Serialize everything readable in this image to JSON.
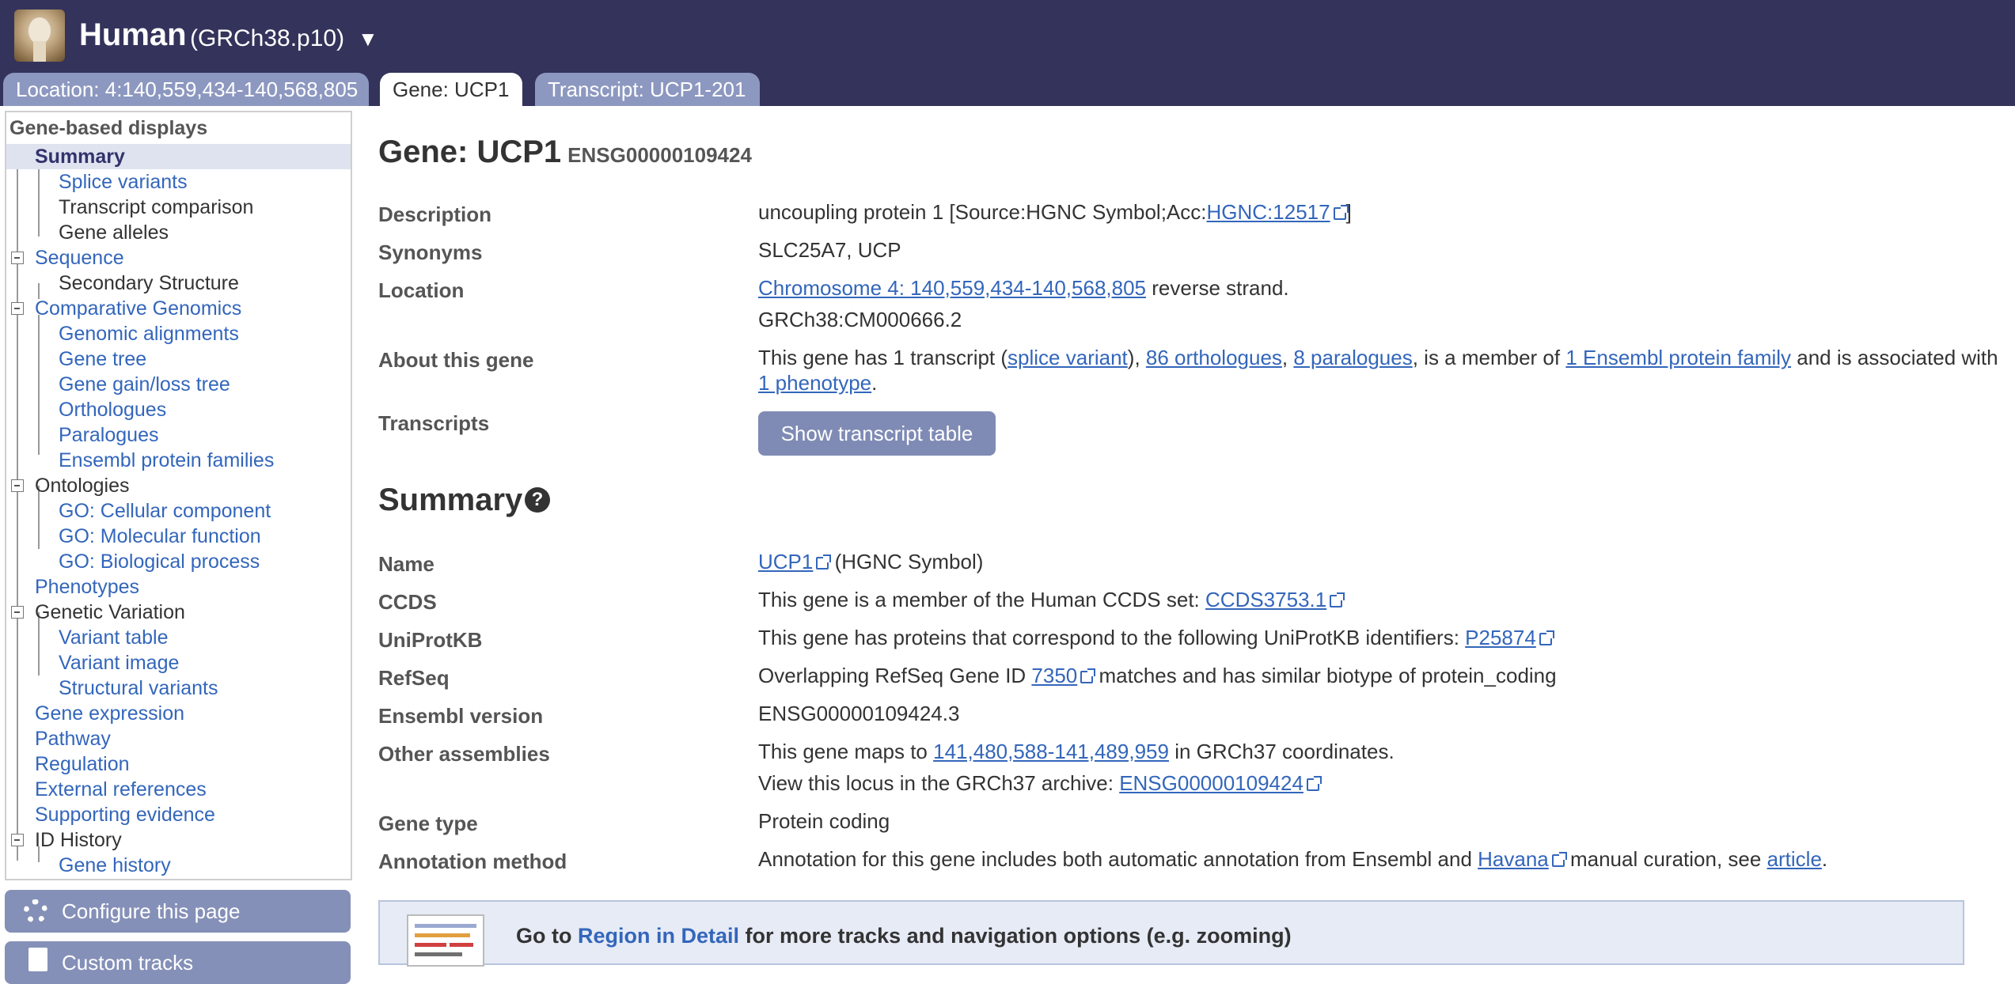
{
  "masthead": {
    "species": "Human",
    "assembly": "(GRCh38.p10)",
    "dropdown_glyph": "▼"
  },
  "tabs": {
    "location": "Location: 4:140,559,434-140,568,805",
    "gene": "Gene: UCP1",
    "transcript": "Transcript: UCP1-201"
  },
  "nav": {
    "heading": "Gene-based displays",
    "items": {
      "summary": "Summary",
      "splice_variants": "Splice variants",
      "transcript_comparison": "Transcript comparison",
      "gene_alleles": "Gene alleles",
      "sequence": "Sequence",
      "secondary_structure": "Secondary Structure",
      "comparative_genomics": "Comparative Genomics",
      "genomic_alignments": "Genomic alignments",
      "gene_tree": "Gene tree",
      "gene_gain_loss_tree": "Gene gain/loss tree",
      "orthologues": "Orthologues",
      "paralogues": "Paralogues",
      "protein_families": "Ensembl protein families",
      "ontologies": "Ontologies",
      "go_cellular": "GO: Cellular component",
      "go_molecular": "GO: Molecular function",
      "go_biological": "GO: Biological process",
      "phenotypes": "Phenotypes",
      "genetic_variation": "Genetic Variation",
      "variant_table": "Variant table",
      "variant_image": "Variant image",
      "structural_variants": "Structural variants",
      "gene_expression": "Gene expression",
      "pathway": "Pathway",
      "regulation": "Regulation",
      "external_references": "External references",
      "supporting_evidence": "Supporting evidence",
      "id_history": "ID History",
      "gene_history": "Gene history"
    },
    "configure_button": "Configure this page",
    "custom_tracks_button": "Custom tracks"
  },
  "gene": {
    "title": "Gene: UCP1",
    "stable_id": "ENSG00000109424",
    "description_label": "Description",
    "description_text": "uncoupling protein 1 [Source:HGNC Symbol;Acc:",
    "description_link": "HGNC:12517",
    "description_end": "]",
    "synonyms_label": "Synonyms",
    "synonyms": "SLC25A7, UCP",
    "location_label": "Location",
    "location_link": "Chromosome 4: 140,559,434-140,568,805",
    "location_strand": " reverse strand.",
    "location_assembly": "GRCh38:CM000666.2",
    "about_label": "About this gene",
    "about": {
      "t1": "This gene has 1 transcript (",
      "l1": "splice variant",
      "t2": "), ",
      "l2": "86 orthologues",
      "t3": ", ",
      "l3": "8 paralogues",
      "t4": ", is a member of ",
      "l4": "1 Ensembl protein family",
      "t5": " and is associated with ",
      "l5": "1 phenotype",
      "t6": "."
    },
    "transcripts_label": "Transcripts",
    "transcript_button": "Show transcript table"
  },
  "summary": {
    "heading": "Summary",
    "help_glyph": "?",
    "name_label": "Name",
    "name_link": "UCP1",
    "name_suffix": " (HGNC Symbol)",
    "ccds_label": "CCDS",
    "ccds_text": "This gene is a member of the Human CCDS set: ",
    "ccds_link": "CCDS3753.1",
    "uniprot_label": "UniProtKB",
    "uniprot_text": "This gene has proteins that correspond to the following UniProtKB identifiers: ",
    "uniprot_link": "P25874",
    "refseq_label": "RefSeq",
    "refseq_text1": "Overlapping RefSeq Gene ID ",
    "refseq_link": "7350",
    "refseq_text2": " matches and has similar biotype of protein_coding",
    "version_label": "Ensembl version",
    "version": "ENSG00000109424.3",
    "other_label": "Other assemblies",
    "other_text1": "This gene maps to ",
    "other_link1": "141,480,588-141,489,959",
    "other_text2": " in GRCh37 coordinates.",
    "other_text3": "View this locus in the GRCh37 archive: ",
    "other_link2": "ENSG00000109424",
    "gene_type_label": "Gene type",
    "gene_type": "Protein coding",
    "annotation_label": "Annotation method",
    "annotation_text1": "Annotation for this gene includes both automatic annotation from Ensembl and ",
    "annotation_link1": "Havana",
    "annotation_text2": " manual curation, see ",
    "annotation_link2": "article",
    "annotation_text3": "."
  },
  "region": {
    "text1": "Go to ",
    "link": "Region in Detail",
    "text2": " for more tracks and navigation options (e.g. zooming)"
  },
  "colors": {
    "masthead": "#33335b",
    "tab_inactive": "#8d98c0",
    "link": "#3366bb",
    "button": "#7f8bb4"
  }
}
